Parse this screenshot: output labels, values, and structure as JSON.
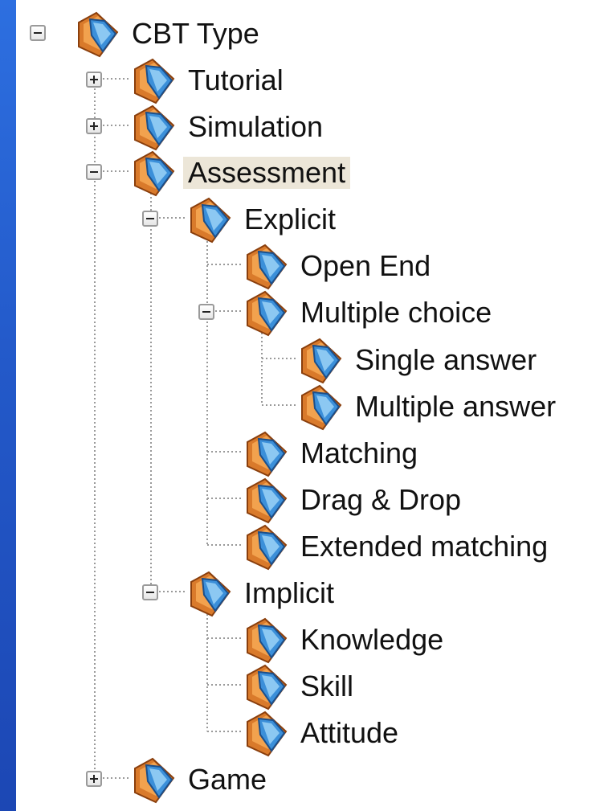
{
  "colors": {
    "selection": "#ece6d8",
    "folder_orange": "#d97a2b",
    "folder_blue": "#3b8fd9",
    "tree_line": "#9a9a9a"
  },
  "tree": {
    "root": {
      "label": "CBT Type",
      "toggle": "minus",
      "icon": "folder-icon"
    },
    "tutorial": {
      "label": "Tutorial",
      "toggle": "plus",
      "icon": "folder-icon"
    },
    "simulation": {
      "label": "Simulation",
      "toggle": "plus",
      "icon": "folder-icon"
    },
    "assessment": {
      "label": "Assessment",
      "toggle": "minus",
      "icon": "folder-icon",
      "selected": true
    },
    "explicit": {
      "label": "Explicit",
      "toggle": "minus",
      "icon": "folder-icon"
    },
    "open_end": {
      "label": "Open End",
      "icon": "folder-icon"
    },
    "multiple_choice": {
      "label": "Multiple choice",
      "toggle": "minus",
      "icon": "folder-icon"
    },
    "single_answer": {
      "label": "Single answer",
      "icon": "folder-icon"
    },
    "multiple_answer": {
      "label": "Multiple answer",
      "icon": "folder-icon"
    },
    "matching": {
      "label": "Matching",
      "icon": "folder-icon"
    },
    "drag_drop": {
      "label": "Drag & Drop",
      "icon": "folder-icon"
    },
    "extended_matching": {
      "label": "Extended matching",
      "icon": "folder-icon"
    },
    "implicit": {
      "label": "Implicit",
      "toggle": "minus",
      "icon": "folder-icon"
    },
    "knowledge": {
      "label": "Knowledge",
      "icon": "folder-icon"
    },
    "skill": {
      "label": "Skill",
      "icon": "folder-icon"
    },
    "attitude": {
      "label": "Attitude",
      "icon": "folder-icon"
    },
    "game": {
      "label": "Game",
      "toggle": "plus",
      "icon": "folder-icon"
    }
  }
}
